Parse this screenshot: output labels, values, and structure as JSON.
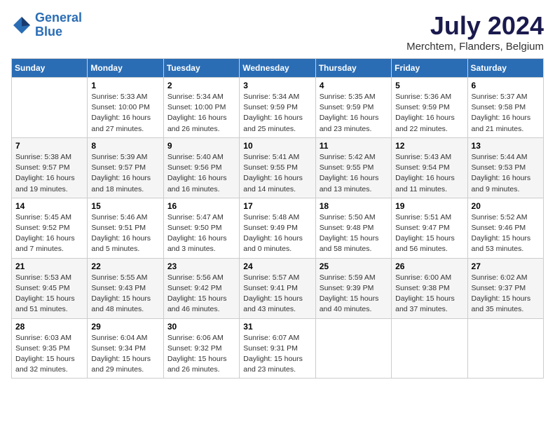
{
  "logo": {
    "line1": "General",
    "line2": "Blue"
  },
  "title": "July 2024",
  "location": "Merchtem, Flanders, Belgium",
  "days_header": [
    "Sunday",
    "Monday",
    "Tuesday",
    "Wednesday",
    "Thursday",
    "Friday",
    "Saturday"
  ],
  "weeks": [
    [
      {
        "num": "",
        "info": ""
      },
      {
        "num": "1",
        "info": "Sunrise: 5:33 AM\nSunset: 10:00 PM\nDaylight: 16 hours\nand 27 minutes."
      },
      {
        "num": "2",
        "info": "Sunrise: 5:34 AM\nSunset: 10:00 PM\nDaylight: 16 hours\nand 26 minutes."
      },
      {
        "num": "3",
        "info": "Sunrise: 5:34 AM\nSunset: 9:59 PM\nDaylight: 16 hours\nand 25 minutes."
      },
      {
        "num": "4",
        "info": "Sunrise: 5:35 AM\nSunset: 9:59 PM\nDaylight: 16 hours\nand 23 minutes."
      },
      {
        "num": "5",
        "info": "Sunrise: 5:36 AM\nSunset: 9:59 PM\nDaylight: 16 hours\nand 22 minutes."
      },
      {
        "num": "6",
        "info": "Sunrise: 5:37 AM\nSunset: 9:58 PM\nDaylight: 16 hours\nand 21 minutes."
      }
    ],
    [
      {
        "num": "7",
        "info": "Sunrise: 5:38 AM\nSunset: 9:57 PM\nDaylight: 16 hours\nand 19 minutes."
      },
      {
        "num": "8",
        "info": "Sunrise: 5:39 AM\nSunset: 9:57 PM\nDaylight: 16 hours\nand 18 minutes."
      },
      {
        "num": "9",
        "info": "Sunrise: 5:40 AM\nSunset: 9:56 PM\nDaylight: 16 hours\nand 16 minutes."
      },
      {
        "num": "10",
        "info": "Sunrise: 5:41 AM\nSunset: 9:55 PM\nDaylight: 16 hours\nand 14 minutes."
      },
      {
        "num": "11",
        "info": "Sunrise: 5:42 AM\nSunset: 9:55 PM\nDaylight: 16 hours\nand 13 minutes."
      },
      {
        "num": "12",
        "info": "Sunrise: 5:43 AM\nSunset: 9:54 PM\nDaylight: 16 hours\nand 11 minutes."
      },
      {
        "num": "13",
        "info": "Sunrise: 5:44 AM\nSunset: 9:53 PM\nDaylight: 16 hours\nand 9 minutes."
      }
    ],
    [
      {
        "num": "14",
        "info": "Sunrise: 5:45 AM\nSunset: 9:52 PM\nDaylight: 16 hours\nand 7 minutes."
      },
      {
        "num": "15",
        "info": "Sunrise: 5:46 AM\nSunset: 9:51 PM\nDaylight: 16 hours\nand 5 minutes."
      },
      {
        "num": "16",
        "info": "Sunrise: 5:47 AM\nSunset: 9:50 PM\nDaylight: 16 hours\nand 3 minutes."
      },
      {
        "num": "17",
        "info": "Sunrise: 5:48 AM\nSunset: 9:49 PM\nDaylight: 16 hours\nand 0 minutes."
      },
      {
        "num": "18",
        "info": "Sunrise: 5:50 AM\nSunset: 9:48 PM\nDaylight: 15 hours\nand 58 minutes."
      },
      {
        "num": "19",
        "info": "Sunrise: 5:51 AM\nSunset: 9:47 PM\nDaylight: 15 hours\nand 56 minutes."
      },
      {
        "num": "20",
        "info": "Sunrise: 5:52 AM\nSunset: 9:46 PM\nDaylight: 15 hours\nand 53 minutes."
      }
    ],
    [
      {
        "num": "21",
        "info": "Sunrise: 5:53 AM\nSunset: 9:45 PM\nDaylight: 15 hours\nand 51 minutes."
      },
      {
        "num": "22",
        "info": "Sunrise: 5:55 AM\nSunset: 9:43 PM\nDaylight: 15 hours\nand 48 minutes."
      },
      {
        "num": "23",
        "info": "Sunrise: 5:56 AM\nSunset: 9:42 PM\nDaylight: 15 hours\nand 46 minutes."
      },
      {
        "num": "24",
        "info": "Sunrise: 5:57 AM\nSunset: 9:41 PM\nDaylight: 15 hours\nand 43 minutes."
      },
      {
        "num": "25",
        "info": "Sunrise: 5:59 AM\nSunset: 9:39 PM\nDaylight: 15 hours\nand 40 minutes."
      },
      {
        "num": "26",
        "info": "Sunrise: 6:00 AM\nSunset: 9:38 PM\nDaylight: 15 hours\nand 37 minutes."
      },
      {
        "num": "27",
        "info": "Sunrise: 6:02 AM\nSunset: 9:37 PM\nDaylight: 15 hours\nand 35 minutes."
      }
    ],
    [
      {
        "num": "28",
        "info": "Sunrise: 6:03 AM\nSunset: 9:35 PM\nDaylight: 15 hours\nand 32 minutes."
      },
      {
        "num": "29",
        "info": "Sunrise: 6:04 AM\nSunset: 9:34 PM\nDaylight: 15 hours\nand 29 minutes."
      },
      {
        "num": "30",
        "info": "Sunrise: 6:06 AM\nSunset: 9:32 PM\nDaylight: 15 hours\nand 26 minutes."
      },
      {
        "num": "31",
        "info": "Sunrise: 6:07 AM\nSunset: 9:31 PM\nDaylight: 15 hours\nand 23 minutes."
      },
      {
        "num": "",
        "info": ""
      },
      {
        "num": "",
        "info": ""
      },
      {
        "num": "",
        "info": ""
      }
    ]
  ]
}
